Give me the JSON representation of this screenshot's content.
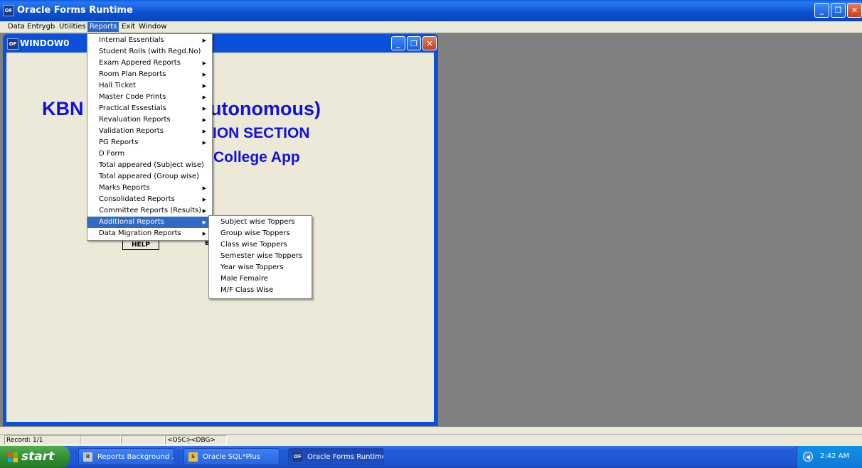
{
  "app": {
    "title": "Oracle Forms Runtime",
    "icon": "oracle-forms-icon"
  },
  "window_controls": {
    "minimize": "_",
    "maximize": "❐",
    "close": "✕"
  },
  "menubar": [
    {
      "label": "Data Entrygb"
    },
    {
      "label": "Utilities"
    },
    {
      "label": "Reports",
      "active": true
    },
    {
      "label": "Exit"
    },
    {
      "label": "Window"
    }
  ],
  "child_window": {
    "title": "WINDOW0",
    "heading_parts": [
      "KBN",
      "utonomous)"
    ],
    "subheading": "ION SECTION",
    "subheading2": "College App",
    "help_label": "HELP",
    "help2_label": "E"
  },
  "reports_menu": [
    {
      "label": "Internal Essentials",
      "submenu": true
    },
    {
      "label": "Student Rolls (with Regd.No)",
      "submenu": false
    },
    {
      "label": "Exam Appered Reports",
      "submenu": true
    },
    {
      "label": "Room Plan Reports",
      "submenu": true
    },
    {
      "label": "Hall Ticket",
      "submenu": true
    },
    {
      "label": "Master Code Prints",
      "submenu": true
    },
    {
      "label": "Practical Essestials",
      "submenu": true
    },
    {
      "label": "Revaluation Reports",
      "submenu": true
    },
    {
      "label": "Validation Reports",
      "submenu": true
    },
    {
      "label": "PG Reports",
      "submenu": true
    },
    {
      "label": "D Form",
      "submenu": false
    },
    {
      "label": "Total appeared (Subject wise)",
      "submenu": false
    },
    {
      "label": "Total appeared (Group wise)",
      "submenu": false
    },
    {
      "label": "Marks Reports",
      "submenu": true
    },
    {
      "label": "Consolidated Reports",
      "submenu": true
    },
    {
      "label": "Committee Reports (Results)",
      "submenu": true
    },
    {
      "label": "Additional Reports",
      "submenu": true,
      "highlighted": true
    },
    {
      "label": "Data Migration Reports",
      "submenu": true
    }
  ],
  "additional_reports_submenu": [
    {
      "label": "Subject wise Toppers"
    },
    {
      "label": "Group wise Toppers"
    },
    {
      "label": "Class wise Toppers"
    },
    {
      "label": "Semester wise Toppers"
    },
    {
      "label": "Year wise Toppers"
    },
    {
      "label": "Male Femalre"
    },
    {
      "label": "M/F Class Wise"
    }
  ],
  "statusbar": {
    "record": "Record: 1/1",
    "osc": "<OSC>",
    "dbg": "<DBG>"
  },
  "taskbar": {
    "start_label": "start",
    "tasks": [
      {
        "label": "Reports Background ...",
        "icon": "reports-icon"
      },
      {
        "label": "Oracle SQL*Plus",
        "icon": "sqlplus-icon"
      },
      {
        "label": "Oracle Forms Runtime",
        "icon": "oracle-forms-icon",
        "active": true
      }
    ],
    "clock": "2:42 AM"
  }
}
